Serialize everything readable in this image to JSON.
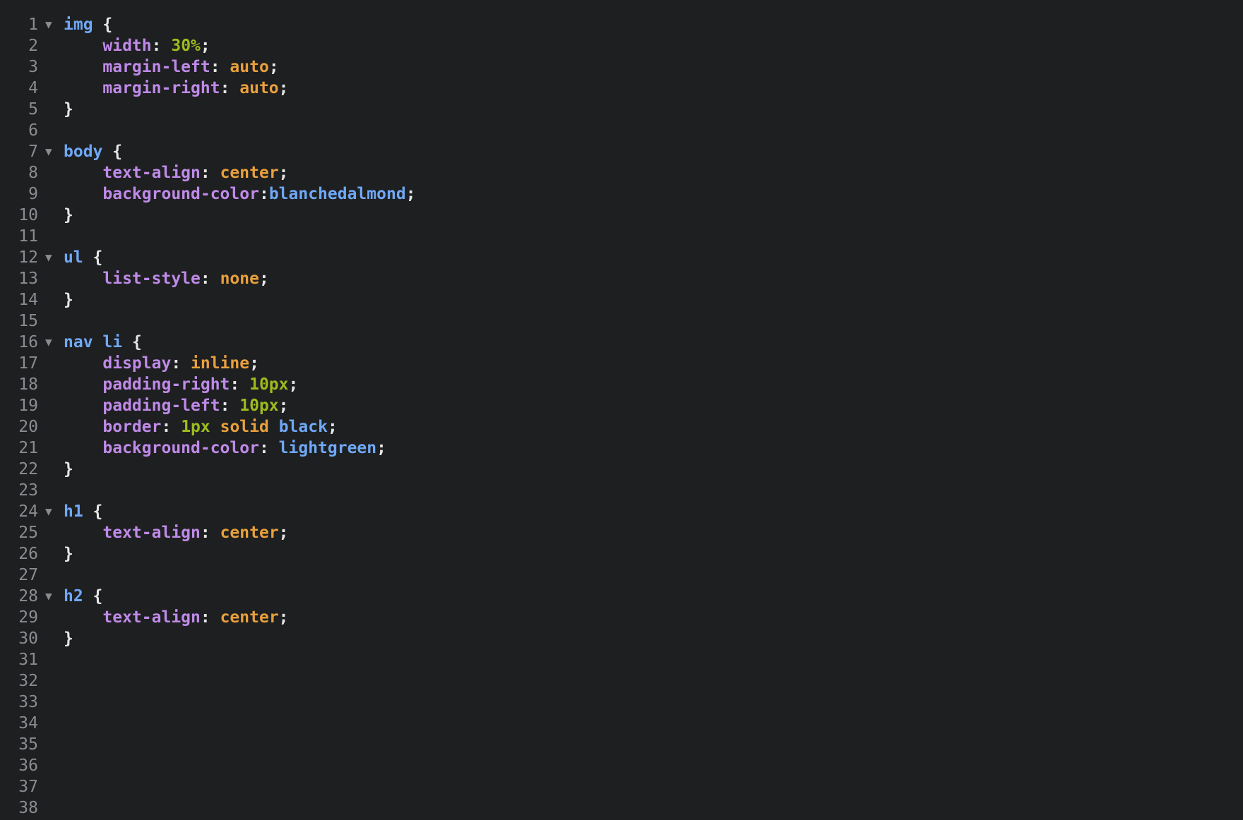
{
  "colors": {
    "background": "#1e1f21",
    "line_number": "#8a8c91",
    "selector": "#6fa8f5",
    "property": "#bf8ae8",
    "keyword_value": "#e8a03c",
    "number_value": "#9dbb1c",
    "named_value": "#6fa8f5",
    "punctuation": "#e6e6e6"
  },
  "fold_icon": "triangle-down",
  "lines": [
    {
      "n": "1",
      "fold": true,
      "tokens": [
        {
          "t": "img",
          "c": "selector"
        },
        {
          "t": " {",
          "c": "punctuation"
        }
      ]
    },
    {
      "n": "2",
      "tokens": [
        {
          "t": "    ",
          "c": "punctuation"
        },
        {
          "t": "width",
          "c": "property"
        },
        {
          "t": ": ",
          "c": "punctuation"
        },
        {
          "t": "30%",
          "c": "number_value"
        },
        {
          "t": ";",
          "c": "punctuation"
        }
      ]
    },
    {
      "n": "3",
      "tokens": [
        {
          "t": "    ",
          "c": "punctuation"
        },
        {
          "t": "margin-left",
          "c": "property"
        },
        {
          "t": ": ",
          "c": "punctuation"
        },
        {
          "t": "auto",
          "c": "keyword_value"
        },
        {
          "t": ";",
          "c": "punctuation"
        }
      ]
    },
    {
      "n": "4",
      "tokens": [
        {
          "t": "    ",
          "c": "punctuation"
        },
        {
          "t": "margin-right",
          "c": "property"
        },
        {
          "t": ": ",
          "c": "punctuation"
        },
        {
          "t": "auto",
          "c": "keyword_value"
        },
        {
          "t": ";",
          "c": "punctuation"
        }
      ]
    },
    {
      "n": "5",
      "tokens": [
        {
          "t": "}",
          "c": "punctuation"
        }
      ]
    },
    {
      "n": "6",
      "tokens": []
    },
    {
      "n": "7",
      "fold": true,
      "tokens": [
        {
          "t": "body",
          "c": "selector"
        },
        {
          "t": " {",
          "c": "punctuation"
        }
      ]
    },
    {
      "n": "8",
      "tokens": [
        {
          "t": "    ",
          "c": "punctuation"
        },
        {
          "t": "text-align",
          "c": "property"
        },
        {
          "t": ": ",
          "c": "punctuation"
        },
        {
          "t": "center",
          "c": "keyword_value"
        },
        {
          "t": ";",
          "c": "punctuation"
        }
      ]
    },
    {
      "n": "9",
      "tokens": [
        {
          "t": "    ",
          "c": "punctuation"
        },
        {
          "t": "background-color",
          "c": "property"
        },
        {
          "t": ":",
          "c": "punctuation"
        },
        {
          "t": "blanchedalmond",
          "c": "named_value"
        },
        {
          "t": ";",
          "c": "punctuation"
        }
      ]
    },
    {
      "n": "10",
      "tokens": [
        {
          "t": "}",
          "c": "punctuation"
        }
      ]
    },
    {
      "n": "11",
      "tokens": []
    },
    {
      "n": "12",
      "fold": true,
      "tokens": [
        {
          "t": "ul",
          "c": "selector"
        },
        {
          "t": " {",
          "c": "punctuation"
        }
      ]
    },
    {
      "n": "13",
      "tokens": [
        {
          "t": "    ",
          "c": "punctuation"
        },
        {
          "t": "list-style",
          "c": "property"
        },
        {
          "t": ": ",
          "c": "punctuation"
        },
        {
          "t": "none",
          "c": "keyword_value"
        },
        {
          "t": ";",
          "c": "punctuation"
        }
      ]
    },
    {
      "n": "14",
      "tokens": [
        {
          "t": "}",
          "c": "punctuation"
        }
      ]
    },
    {
      "n": "15",
      "tokens": []
    },
    {
      "n": "16",
      "fold": true,
      "tokens": [
        {
          "t": "nav",
          "c": "selector"
        },
        {
          "t": " ",
          "c": "punctuation"
        },
        {
          "t": "li",
          "c": "selector"
        },
        {
          "t": " {",
          "c": "punctuation"
        }
      ]
    },
    {
      "n": "17",
      "tokens": [
        {
          "t": "    ",
          "c": "punctuation"
        },
        {
          "t": "display",
          "c": "property"
        },
        {
          "t": ": ",
          "c": "punctuation"
        },
        {
          "t": "inline",
          "c": "keyword_value"
        },
        {
          "t": ";",
          "c": "punctuation"
        }
      ]
    },
    {
      "n": "18",
      "tokens": [
        {
          "t": "    ",
          "c": "punctuation"
        },
        {
          "t": "padding-right",
          "c": "property"
        },
        {
          "t": ": ",
          "c": "punctuation"
        },
        {
          "t": "10px",
          "c": "number_value"
        },
        {
          "t": ";",
          "c": "punctuation"
        }
      ]
    },
    {
      "n": "19",
      "tokens": [
        {
          "t": "    ",
          "c": "punctuation"
        },
        {
          "t": "padding-left",
          "c": "property"
        },
        {
          "t": ": ",
          "c": "punctuation"
        },
        {
          "t": "10px",
          "c": "number_value"
        },
        {
          "t": ";",
          "c": "punctuation"
        }
      ]
    },
    {
      "n": "20",
      "tokens": [
        {
          "t": "    ",
          "c": "punctuation"
        },
        {
          "t": "border",
          "c": "property"
        },
        {
          "t": ": ",
          "c": "punctuation"
        },
        {
          "t": "1px",
          "c": "number_value"
        },
        {
          "t": " ",
          "c": "punctuation"
        },
        {
          "t": "solid",
          "c": "keyword_value"
        },
        {
          "t": " ",
          "c": "punctuation"
        },
        {
          "t": "black",
          "c": "named_value"
        },
        {
          "t": ";",
          "c": "punctuation"
        }
      ]
    },
    {
      "n": "21",
      "tokens": [
        {
          "t": "    ",
          "c": "punctuation"
        },
        {
          "t": "background-color",
          "c": "property"
        },
        {
          "t": ": ",
          "c": "punctuation"
        },
        {
          "t": "lightgreen",
          "c": "named_value"
        },
        {
          "t": ";",
          "c": "punctuation"
        }
      ]
    },
    {
      "n": "22",
      "tokens": [
        {
          "t": "}",
          "c": "punctuation"
        }
      ]
    },
    {
      "n": "23",
      "tokens": []
    },
    {
      "n": "24",
      "fold": true,
      "tokens": [
        {
          "t": "h1",
          "c": "selector"
        },
        {
          "t": " {",
          "c": "punctuation"
        }
      ]
    },
    {
      "n": "25",
      "tokens": [
        {
          "t": "    ",
          "c": "punctuation"
        },
        {
          "t": "text-align",
          "c": "property"
        },
        {
          "t": ": ",
          "c": "punctuation"
        },
        {
          "t": "center",
          "c": "keyword_value"
        },
        {
          "t": ";",
          "c": "punctuation"
        }
      ]
    },
    {
      "n": "26",
      "tokens": [
        {
          "t": "}",
          "c": "punctuation"
        }
      ]
    },
    {
      "n": "27",
      "tokens": []
    },
    {
      "n": "28",
      "fold": true,
      "tokens": [
        {
          "t": "h2",
          "c": "selector"
        },
        {
          "t": " {",
          "c": "punctuation"
        }
      ]
    },
    {
      "n": "29",
      "tokens": [
        {
          "t": "    ",
          "c": "punctuation"
        },
        {
          "t": "text-align",
          "c": "property"
        },
        {
          "t": ": ",
          "c": "punctuation"
        },
        {
          "t": "center",
          "c": "keyword_value"
        },
        {
          "t": ";",
          "c": "punctuation"
        }
      ]
    },
    {
      "n": "30",
      "tokens": [
        {
          "t": "}",
          "c": "punctuation"
        }
      ]
    },
    {
      "n": "31",
      "tokens": []
    },
    {
      "n": "32",
      "tokens": []
    },
    {
      "n": "33",
      "tokens": []
    },
    {
      "n": "34",
      "tokens": []
    },
    {
      "n": "35",
      "tokens": []
    },
    {
      "n": "36",
      "tokens": []
    },
    {
      "n": "37",
      "tokens": []
    },
    {
      "n": "38",
      "tokens": []
    }
  ]
}
